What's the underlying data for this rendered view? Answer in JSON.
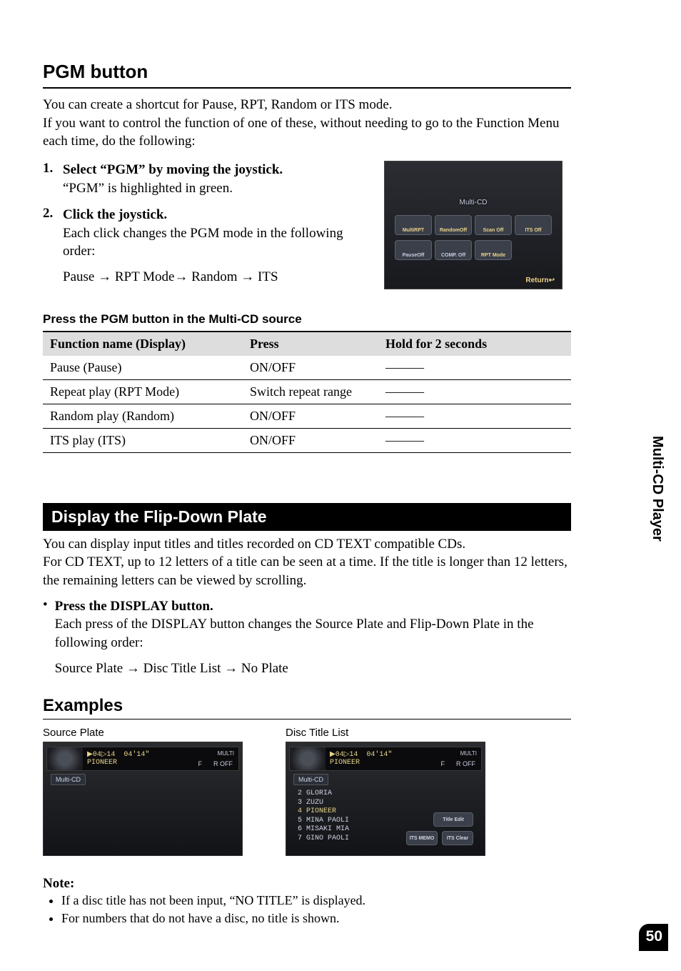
{
  "sideTab": "Multi-CD Player",
  "pageNum": "50",
  "pgm": {
    "heading": "PGM button",
    "intro1": "You can create a shortcut for Pause, RPT, Random or ITS mode.",
    "intro2": "If you want to control the function of one of these, without needing to go to the Function Menu each time, do the following:",
    "steps": [
      {
        "num": "1.",
        "bold": "Select “PGM” by moving the joystick.",
        "rest": "“PGM” is highlighted in green."
      },
      {
        "num": "2.",
        "bold": "Click the joystick.",
        "rest": "Each click changes the PGM mode in the following order:"
      }
    ],
    "orderLine": "Pause → RPT Mode→ Random → ITS",
    "screenshot": {
      "top": "Multi-CD",
      "row1": [
        "MultiRPT",
        "RandomOff",
        "Scan Off",
        "ITS Off"
      ],
      "row2": [
        "PauseOff",
        "COMP. Off",
        "RPT Mode"
      ],
      "return": "Return↩"
    },
    "tableTitle": "Press the PGM button in the Multi-CD source",
    "tableHead": {
      "c1": "Function name (Display)",
      "c2": "Press",
      "c3": "Hold for 2 seconds"
    },
    "tableRows": [
      {
        "c1": "Pause (Pause)",
        "c2": "ON/OFF",
        "c3": "———"
      },
      {
        "c1": "Repeat play (RPT Mode)",
        "c2": "Switch repeat range",
        "c3": "———"
      },
      {
        "c1": "Random play (Random)",
        "c2": "ON/OFF",
        "c3": "———"
      },
      {
        "c1": "ITS play (ITS)",
        "c2": "ON/OFF",
        "c3": "———"
      }
    ]
  },
  "flip": {
    "heading": "Display the Flip-Down Plate",
    "p1": "You can display input titles and titles recorded on CD TEXT compatible CDs.",
    "p2": "For CD TEXT, up to 12 letters of a title can be seen at a time. If the title is longer than 12 letters, the remaining letters can be viewed by scrolling.",
    "bulletBold": "Press the DISPLAY button.",
    "bulletRest": "Each press of the DISPLAY button changes the Source Plate and Flip-Down Plate in the following order:",
    "orderLine": "Source Plate → Disc Title List → No Plate"
  },
  "examples": {
    "heading": "Examples",
    "left": {
      "label": "Source Plate",
      "line1": "▶04▷14  04'14\"",
      "line2": "PIONEER",
      "rightTop": "MULTI",
      "rightBadges": [
        "F",
        "R  OFF"
      ],
      "tag": "Multi-CD"
    },
    "right": {
      "label": "Disc Title List",
      "line1": "▶04▷14  04'14\"",
      "line2": "PIONEER",
      "rightTop": "MULTI",
      "rightBadges": [
        "F",
        "R  OFF"
      ],
      "tag": "Multi-CD",
      "list": [
        "2 GLORIA",
        "3 ZUZU",
        "4 PIONEER",
        "5 MINA PAOLI",
        "6 MISAKI MIA",
        "7 GINO PAOLI"
      ],
      "btnTop": "Title Edit",
      "btnBottom": [
        "ITS MEMO",
        "ITS Clear"
      ]
    }
  },
  "note": {
    "heading": "Note:",
    "items": [
      "If a disc title has not been input, “NO TITLE” is displayed.",
      "For numbers that do not have a disc, no title is shown."
    ]
  }
}
